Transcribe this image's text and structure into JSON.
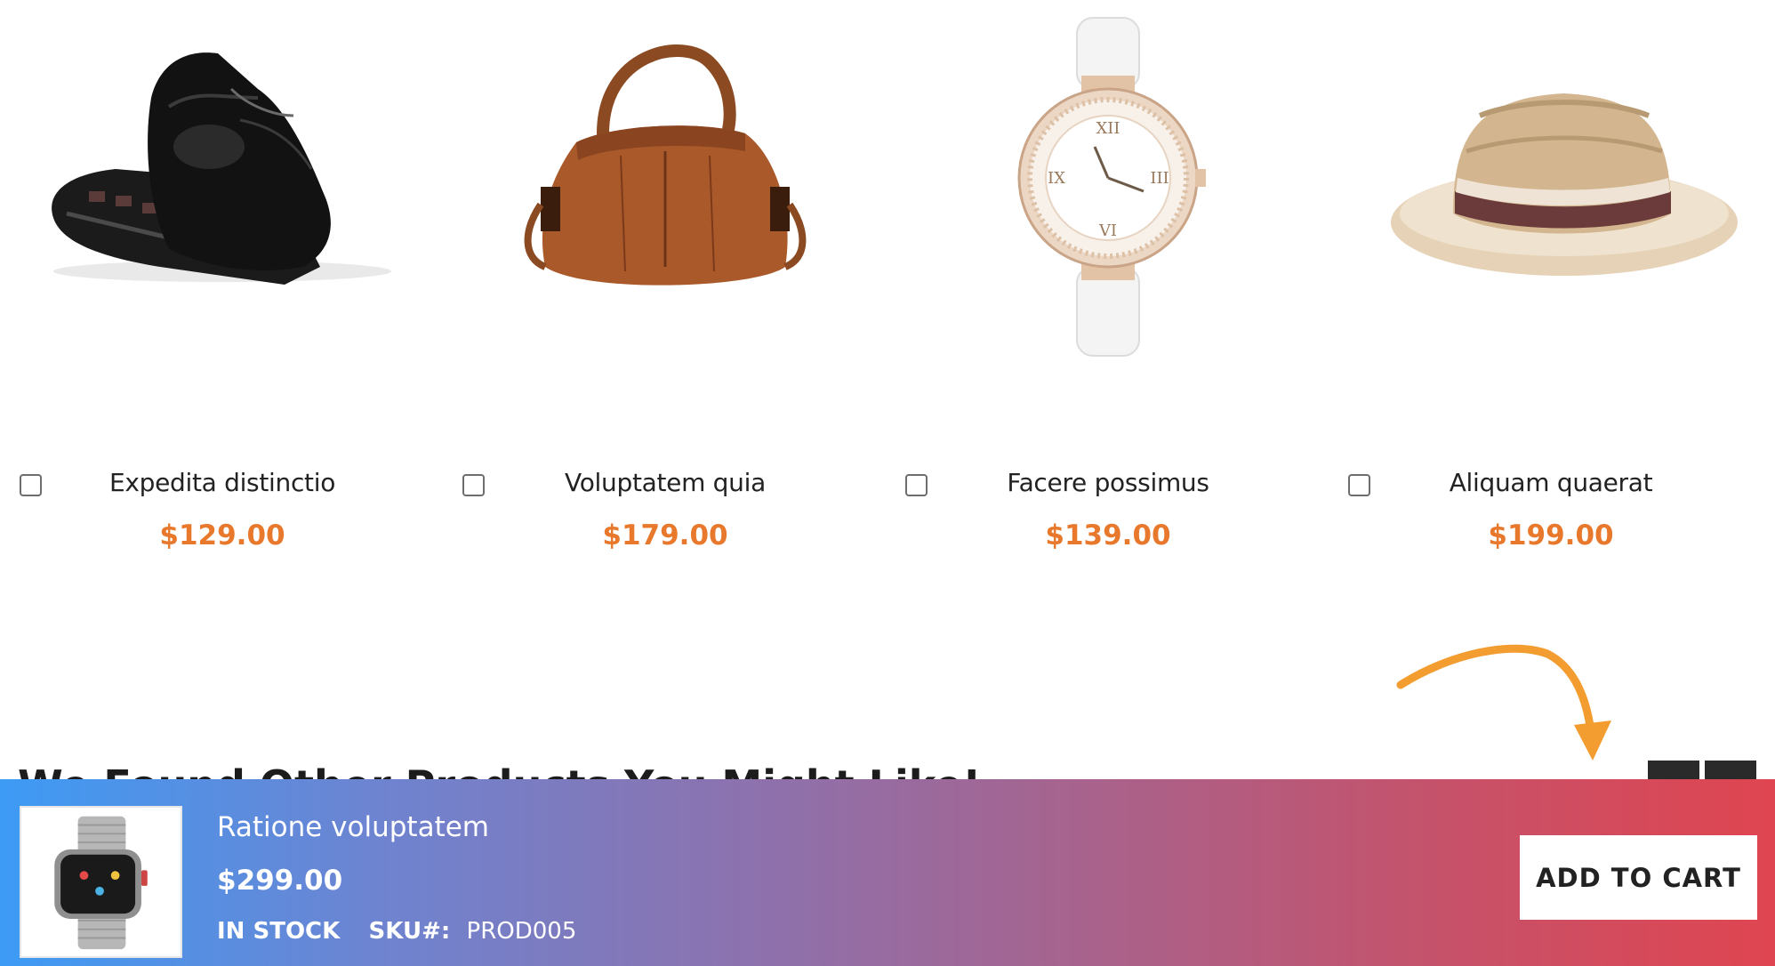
{
  "products": [
    {
      "name": "Expedita distinctio",
      "price": "$129.00",
      "image": "shoe-image"
    },
    {
      "name": "Voluptatem quia",
      "price": "$179.00",
      "image": "handbag-image"
    },
    {
      "name": "Facere possimus",
      "price": "$139.00",
      "image": "watch-image"
    },
    {
      "name": "Aliquam quaerat",
      "price": "$199.00",
      "image": "hat-image"
    }
  ],
  "section": {
    "heading": "We Found Other Products You Might Like!"
  },
  "sticky_bar": {
    "product_name": "Ratione voluptatem",
    "price": "$299.00",
    "stock_status": "IN STOCK",
    "sku_label": "SKU#:",
    "sku_value": "PROD005",
    "add_to_cart_label": "ADD TO CART",
    "thumbnail": "smartwatch-image"
  },
  "colors": {
    "price": "#e8782b",
    "arrow": "#f39c2f",
    "bar_gradient_start": "#3d9bf5",
    "bar_gradient_end": "#df4550"
  }
}
